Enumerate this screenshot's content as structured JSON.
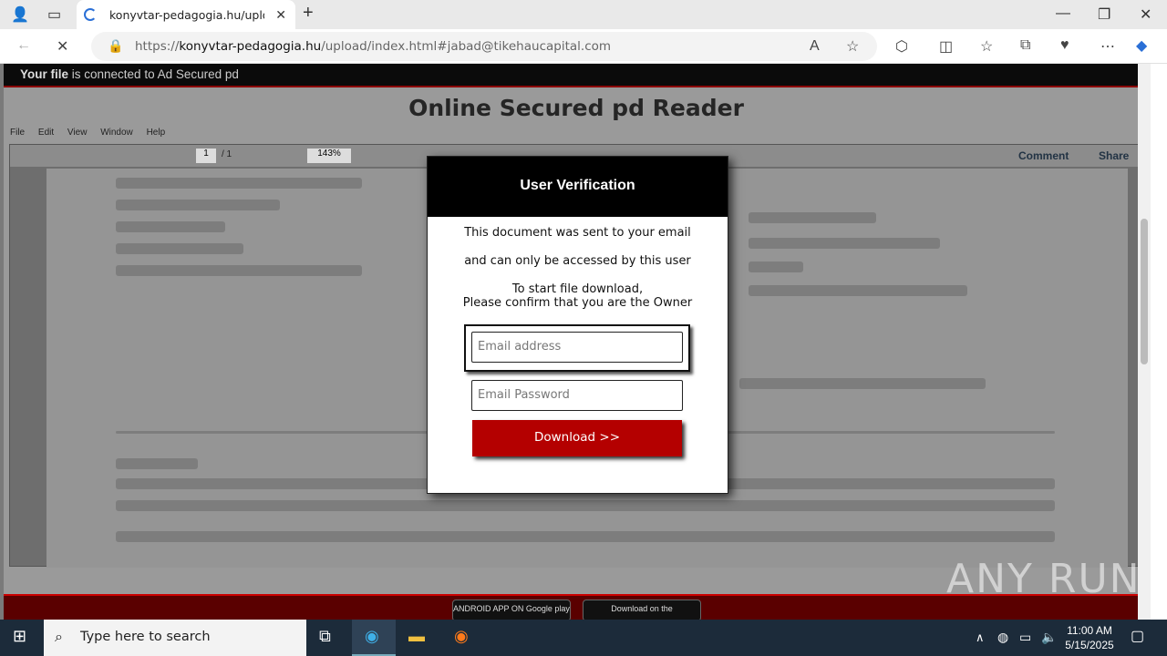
{
  "browser": {
    "tab_title": "konyvtar-pedagogia.hu/upload/i",
    "url_prefix": "https://",
    "url_domain": "konyvtar-pedagogia.hu",
    "url_path": "/upload/index.html#jabad@tikehaucapital.com"
  },
  "page": {
    "top_strip_bold": "Your file",
    "top_strip_rest": " is connected to Ad Secured pd",
    "headline": "Online Secured pd Reader",
    "menu": [
      "File",
      "Edit",
      "View",
      "Window",
      "Help"
    ],
    "toolbar_page": "1",
    "toolbar_pages": "/ 1",
    "toolbar_zoom": "143%",
    "toolbar_comment": "Comment",
    "toolbar_share": "Share",
    "store_google": "ANDROID APP ON Google play",
    "store_apple": "Download on the",
    "watermark": "ANY RUN"
  },
  "modal": {
    "title": "User Verification",
    "line1": "This document was sent to your email",
    "line2": "and can only be accessed by this user",
    "line3": "To start file download,",
    "line4": "Please confirm that you are the Owner",
    "email_placeholder": "Email address",
    "password_placeholder": "Email Password",
    "download_label": "Download >>"
  },
  "taskbar": {
    "search_placeholder": "Type here to search",
    "time": "11:00 AM",
    "date": "5/15/2025"
  }
}
